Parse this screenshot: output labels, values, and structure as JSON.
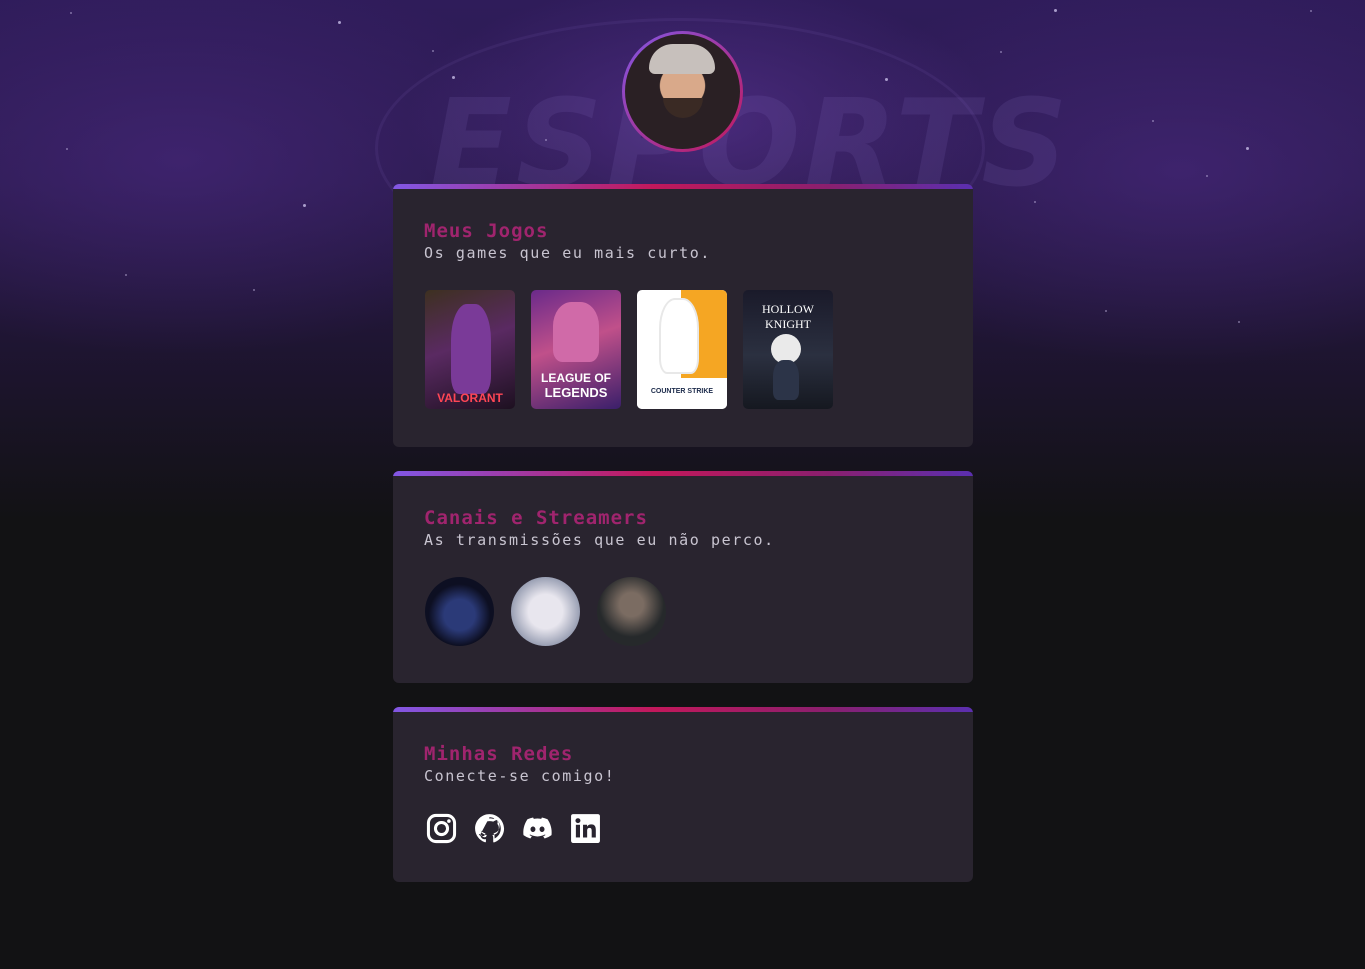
{
  "games_card": {
    "title": "Meus Jogos",
    "subtitle": "Os games que eu mais curto.",
    "games": [
      {
        "name": "VALORANT",
        "name_lines": [
          "VALORANT"
        ]
      },
      {
        "name": "LEAGUE OF LEGENDS",
        "name_lines": [
          "LEAGUE OF",
          "LEGENDS"
        ]
      },
      {
        "name": "COUNTER STRIKE",
        "name_lines": [
          "COUNTER STRIKE"
        ]
      },
      {
        "name": "HOLLOW KNIGHT",
        "name_lines": [
          "HOLLOW KNIGHT"
        ]
      }
    ]
  },
  "streamers_card": {
    "title": "Canais e Streamers",
    "subtitle": "As transmissões que eu não perco."
  },
  "social_card": {
    "title": "Minhas Redes",
    "subtitle": "Conecte-se comigo!",
    "icons": [
      "instagram-icon",
      "github-icon",
      "discord-icon",
      "linkedin-icon"
    ]
  },
  "background_text": "ESPORTS",
  "colors": {
    "accent_purple": "#8257e5",
    "accent_pink": "#c2185b",
    "title": "#a0246e",
    "card_bg": "#29242f",
    "page_bg": "#121214"
  }
}
